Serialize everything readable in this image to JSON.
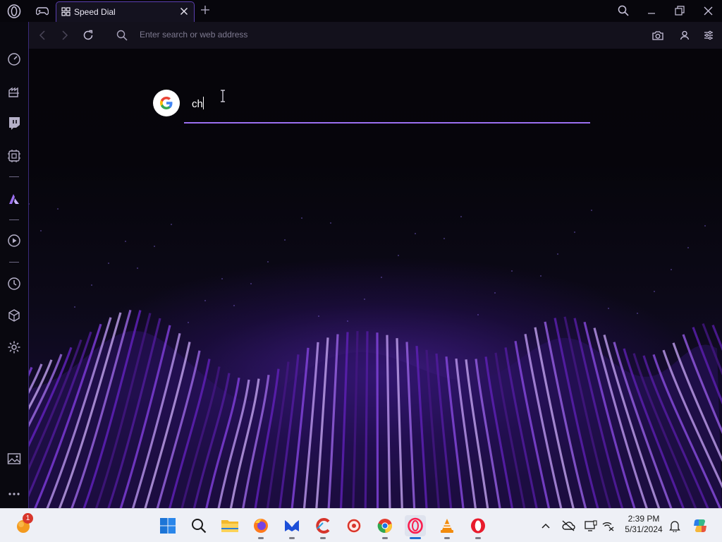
{
  "titlebar": {
    "tab_title": "Speed Dial"
  },
  "addressbar": {
    "placeholder": "Enter search or web address"
  },
  "speed_dial": {
    "search_engine": "Google",
    "search_query": "ch"
  },
  "sidebar": {
    "items": [
      "speed-dial",
      "gx-control",
      "twitch",
      "gx-corner",
      "aria",
      "player",
      "history",
      "extensions",
      "settings",
      "wallpaper",
      "more"
    ]
  },
  "taskbar": {
    "weather_badge": "1",
    "apps": [
      "widgets",
      "start",
      "search",
      "file-explorer",
      "firefox",
      "malwarebytes",
      "ccleaner",
      "pdf-app",
      "chrome",
      "opera-gx",
      "vlc",
      "opera"
    ],
    "time": "2:39 PM",
    "date": "5/31/2024"
  },
  "colors": {
    "accent": "#9b6ff0",
    "tab_border": "#5b3fb0",
    "background": "#06050a"
  }
}
